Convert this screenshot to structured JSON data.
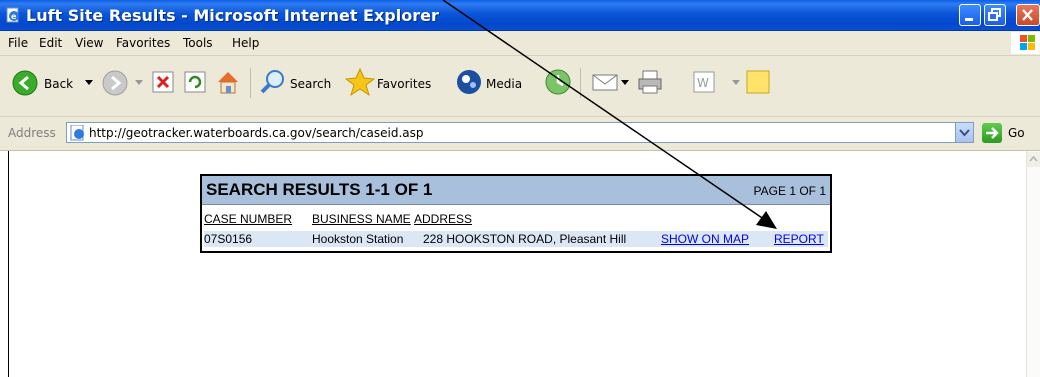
{
  "window": {
    "title": "Luft Site Results - Microsoft Internet Explorer"
  },
  "menu": [
    "File",
    "Edit",
    "View",
    "Favorites",
    "Tools",
    "Help"
  ],
  "toolbar": {
    "back": "Back",
    "search": "Search",
    "favorites": "Favorites",
    "media": "Media"
  },
  "address": {
    "label": "Address",
    "url": "http://geotracker.waterboards.ca.gov/search/caseid.asp",
    "go": "Go"
  },
  "results": {
    "title": "SEARCH RESULTS 1-1 OF 1",
    "page": "PAGE 1 OF 1",
    "columns": [
      "CASE NUMBER",
      "BUSINESS NAME",
      "ADDRESS"
    ],
    "row": {
      "case_number": "07S0156",
      "business_name": "Hookston Station",
      "address": "228 HOOKSTON ROAD, Pleasant Hill",
      "map_link": "SHOW ON MAP",
      "report_link": "REPORT"
    }
  },
  "colors": {
    "titlebar": "#0a56d8",
    "chrome": "#ece9d8",
    "results_header": "#a8c0dc",
    "row_highlight": "#dbe7f5",
    "link": "#0000ee"
  }
}
